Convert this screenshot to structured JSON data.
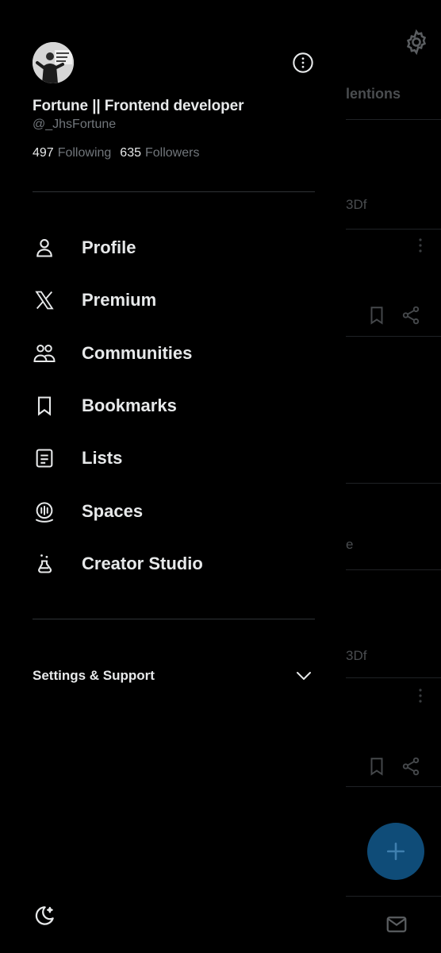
{
  "profile": {
    "display_name": "Fortune || Frontend developer",
    "handle": "@_JhsFortune",
    "following_count": "497",
    "following_label": "Following",
    "followers_count": "635",
    "followers_label": "Followers"
  },
  "menu": [
    {
      "label": "Profile",
      "icon": "person-icon"
    },
    {
      "label": "Premium",
      "icon": "x-logo-icon"
    },
    {
      "label": "Communities",
      "icon": "communities-icon"
    },
    {
      "label": "Bookmarks",
      "icon": "bookmark-icon"
    },
    {
      "label": "Lists",
      "icon": "list-icon"
    },
    {
      "label": "Spaces",
      "icon": "spaces-icon"
    },
    {
      "label": "Creator Studio",
      "icon": "flask-icon"
    }
  ],
  "settings_support": {
    "label": "Settings & Support",
    "icon": "chevron-down-icon"
  },
  "background": {
    "tab_partial": "lentions",
    "text_partial_1": "3Df",
    "text_partial_2": "e",
    "text_partial_3": "3Df"
  },
  "colors": {
    "background": "#000000",
    "text_primary": "#e7e9ea",
    "text_secondary": "#71767b",
    "divider": "#2f3336",
    "fab": "#0f4c78"
  }
}
